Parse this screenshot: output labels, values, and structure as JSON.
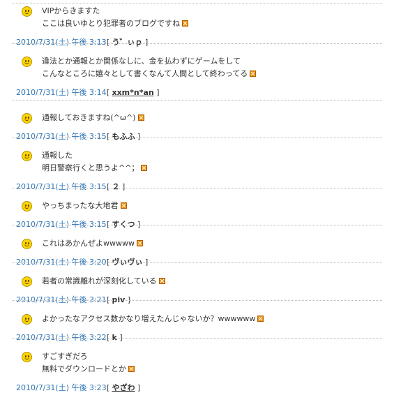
{
  "comments": [
    {
      "lines": [
        "VIPからきますた",
        "ここは良いゆとり犯罪者のブログですね"
      ],
      "date": "2010/7/31(土) 午後 3:13",
      "name": "う゛ぃｐ"
    },
    {
      "lines": [
        "違法とか通報とか関係なしに、金を払わずにゲームをして",
        "こんなところに嬉々として書くなんて人間として終わってる"
      ],
      "date": "2010/7/31(土) 午後 3:14",
      "name": "xxm*n*an"
    },
    {
      "lines": [
        "通報しておきますね(^ω^)"
      ],
      "date": "2010/7/31(土) 午後 3:15",
      "name": "もふふ"
    },
    {
      "lines": [
        "通報した",
        "明日警察行くと思うよ^^；"
      ],
      "date": "2010/7/31(土) 午後 3:15",
      "name": "２"
    },
    {
      "lines": [
        "やっちまったな大地君"
      ],
      "date": "2010/7/31(土) 午後 3:15",
      "name": "すくつ"
    },
    {
      "lines": [
        "これはあかんぜよwwwww"
      ],
      "date": "2010/7/31(土) 午後 3:20",
      "name": "ヴぃヴぃ"
    },
    {
      "lines": [
        "若者の常識離れが深刻化している"
      ],
      "date": "2010/7/31(土) 午後 3:21",
      "name": "piv"
    },
    {
      "lines": [
        "よかったなアクセス数かなり増えたんじゃないか？wwwwww"
      ],
      "date": "2010/7/31(土) 午後 3:22",
      "name": "k"
    },
    {
      "lines": [
        "すごすぎだろ",
        "無料でダウンロードとか"
      ],
      "date": "2010/7/31(土) 午後 3:23",
      "name": "やざわ"
    }
  ],
  "bracket_open": "[",
  "bracket_close": "]",
  "icons": {
    "avatar": "smiley-icon",
    "delete": "delete-icon"
  },
  "colors": {
    "date": "#2c73b3",
    "separator": "#b8b8b8",
    "delete_icon": "#e88d00",
    "smiley": "#ffd400"
  }
}
